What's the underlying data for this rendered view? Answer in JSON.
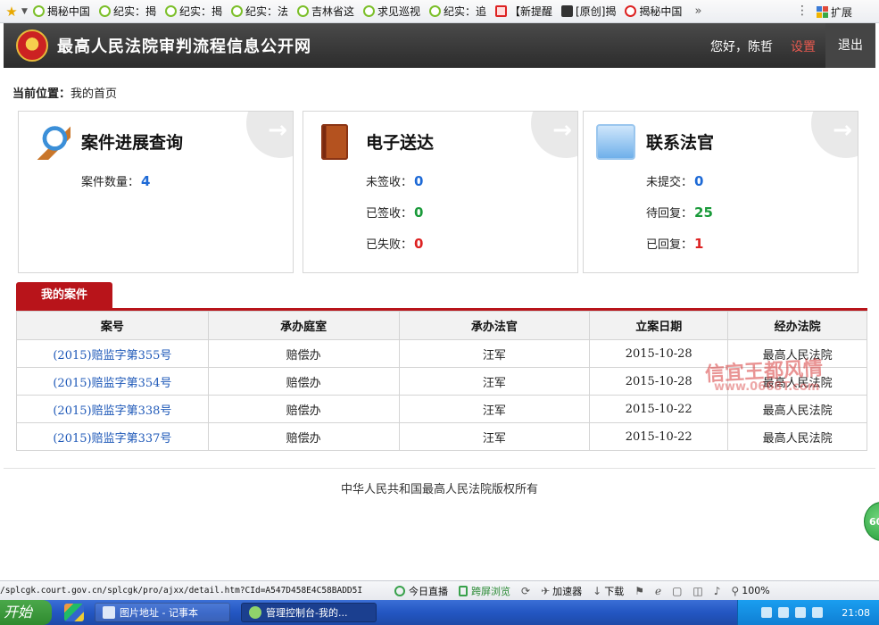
{
  "favorites": {
    "items": [
      {
        "label": "揭秘中国",
        "icon": "loading-circle-icon"
      },
      {
        "label": "纪实：揭",
        "icon": "loading-circle-icon"
      },
      {
        "label": "纪实：揭",
        "icon": "loading-circle-icon"
      },
      {
        "label": "纪实：法",
        "icon": "loading-circle-icon"
      },
      {
        "label": "吉林省这",
        "icon": "loading-circle-icon"
      },
      {
        "label": "求见巡视",
        "icon": "loading-circle-icon"
      },
      {
        "label": "纪实：追",
        "icon": "loading-circle-icon"
      },
      {
        "label": "【新提醒",
        "icon": "news-icon"
      },
      {
        "label": "[原创]揭",
        "icon": "forum-icon"
      },
      {
        "label": "揭秘中国",
        "icon": "weibo-icon"
      }
    ],
    "more": "»",
    "extensions_label": "扩展"
  },
  "header": {
    "site_title": "最高人民法院审判流程信息公开网",
    "greeting": "您好，陈哲",
    "settings_label": "设置",
    "logout_label": "退出"
  },
  "breadcrumb": {
    "label": "当前位置：",
    "current": "我的首页"
  },
  "cards": {
    "case_progress": {
      "title": "案件进展查询",
      "rows": [
        {
          "label": "案件数量：",
          "value": "4"
        }
      ]
    },
    "e_delivery": {
      "title": "电子送达",
      "rows": [
        {
          "label": "未签收：",
          "value": "0"
        },
        {
          "label": "已签收：",
          "value": "0"
        },
        {
          "label": "已失败：",
          "value": "0"
        }
      ]
    },
    "contact_judge": {
      "title": "联系法官",
      "rows": [
        {
          "label": "未提交：",
          "value": "0"
        },
        {
          "label": "待回复：",
          "value": "25"
        },
        {
          "label": "已回复：",
          "value": "1"
        }
      ]
    }
  },
  "my_cases": {
    "tab_label": "我的案件",
    "columns": [
      "案号",
      "承办庭室",
      "承办法官",
      "立案日期",
      "经办法院"
    ],
    "rows": [
      [
        "(2015)赔监字第355号",
        "赔偿办",
        "汪军",
        "2015-10-28",
        "最高人民法院"
      ],
      [
        "(2015)赔监字第354号",
        "赔偿办",
        "汪军",
        "2015-10-28",
        "最高人民法院"
      ],
      [
        "(2015)赔监字第338号",
        "赔偿办",
        "汪军",
        "2015-10-22",
        "最高人民法院"
      ],
      [
        "(2015)赔监字第337号",
        "赔偿办",
        "汪军",
        "2015-10-22",
        "最高人民法院"
      ]
    ]
  },
  "watermark": {
    "text": "信宜王都风情",
    "url": "www.0668T.com"
  },
  "footer": {
    "copyright": "中华人民共和国最高人民法院版权所有"
  },
  "float_badge": "60",
  "statusbar": {
    "url": "/splcgk.court.gov.cn/splcgk/pro/ajxx/detail.htm?CId=A547D458E4C58BADD5I",
    "items": [
      "今日直播",
      "跨屏浏览",
      "加速器",
      "下载"
    ],
    "zoom": "100%"
  },
  "taskbar": {
    "start_label": "开始",
    "tasks": [
      "图片地址 - 记事本",
      "管理控制台-我的..."
    ],
    "clock": "21:08"
  },
  "colors": {
    "accent_red": "#b8141a",
    "value_blue": "#1e6ad6",
    "value_green": "#1a9a3a",
    "value_red": "#dd2222",
    "header_bg": "#3a3a3a"
  }
}
